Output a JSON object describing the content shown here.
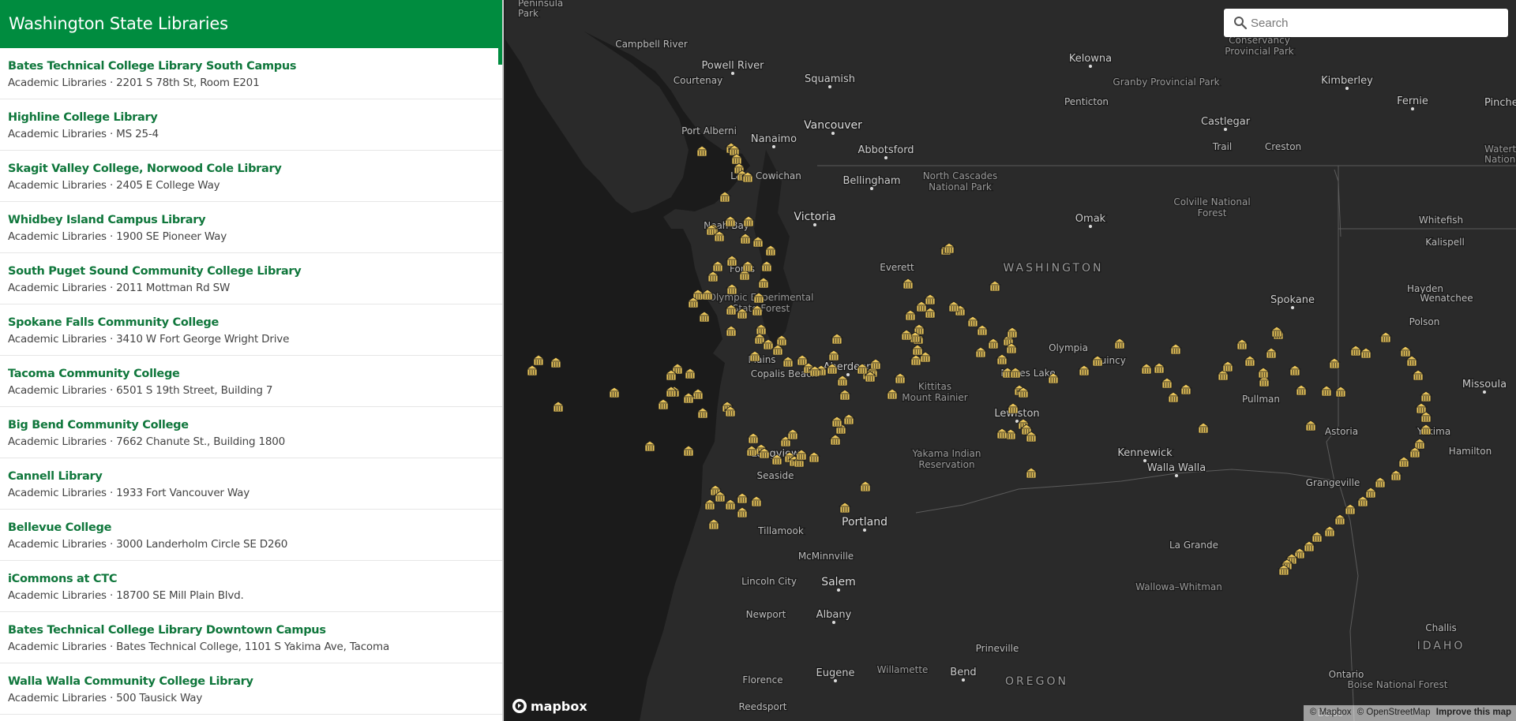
{
  "sidebar": {
    "title": "Washington State Libraries",
    "listings": [
      {
        "title": "Bates Technical College Library South Campus",
        "details": "Academic Libraries · 2201 S 78th St, Room E201"
      },
      {
        "title": "Highline College Library",
        "details": "Academic Libraries · MS 25-4"
      },
      {
        "title": "Skagit Valley College, Norwood Cole Library",
        "details": "Academic Libraries · 2405 E College Way"
      },
      {
        "title": "Whidbey Island Campus Library",
        "details": "Academic Libraries · 1900 SE Pioneer Way"
      },
      {
        "title": "South Puget Sound Community College Library",
        "details": "Academic Libraries · 2011 Mottman Rd SW"
      },
      {
        "title": "Spokane Falls Community College",
        "details": "Academic Libraries · 3410 W Fort George Wright Drive"
      },
      {
        "title": "Tacoma Community College",
        "details": "Academic Libraries · 6501 S 19th Street, Building 7"
      },
      {
        "title": "Big Bend Community College",
        "details": "Academic Libraries · 7662 Chanute St., Building 1800"
      },
      {
        "title": "Cannell Library",
        "details": "Academic Libraries · 1933 Fort Vancouver Way"
      },
      {
        "title": "Bellevue College",
        "details": "Academic Libraries · 3000 Landerholm Circle SE D260"
      },
      {
        "title": "iCommons at CTC",
        "details": "Academic Libraries · 18700 SE Mill Plain Blvd."
      },
      {
        "title": "Bates Technical College Library Downtown Campus",
        "details": "Academic Libraries · Bates Technical College, 1101 S Yakima Ave, Tacoma"
      },
      {
        "title": "Walla Walla Community College Library",
        "details": "Academic Libraries · 500 Tausick Way"
      }
    ]
  },
  "map": {
    "search_placeholder": "Search",
    "logo_text": "mapbox",
    "attribution": [
      "© Mapbox",
      "© OpenStreetMap"
    ],
    "improve_label": "Improve this map",
    "marker_color": "#e8c45a",
    "place_labels": [
      "Peninsula",
      "Park",
      "Campbell River",
      "Powell River",
      "Squamish",
      "Kelowna",
      "Conservancy",
      "Provincial Park",
      "Courtenay",
      "Granby Provincial Park",
      "Kimberley",
      "Fernie",
      "Pincher Cree",
      "Port Alberni",
      "Nanaimo",
      "Vancouver",
      "Penticton",
      "Castlegar",
      "Trail",
      "Creston",
      "Waterton Lak",
      "National Par",
      "Abbotsford",
      "Lake Cowichan",
      "North Cascades",
      "National Park",
      "Bellingham",
      "Colville National",
      "Forest",
      "Neah Bay",
      "Victoria",
      "Omak",
      "Whitefish",
      "Kalispell",
      "Forks",
      "Everett",
      "WASHINGTON",
      "Spokane",
      "Hayden",
      "Olympic Experimental",
      "State Forest",
      "Wenatchee",
      "Polson",
      "Plains",
      "Copalis Beach",
      "Aberdeen",
      "Olympia",
      "Quincy",
      "Moses Lake",
      "Kittitas",
      "Mount Rainier",
      "Missoula",
      "Pullman",
      "Yakima",
      "Lewiston",
      "Astoria",
      "Longview",
      "Yakama Indian",
      "Reservation",
      "Kennewick",
      "Walla Walla",
      "Hamilton",
      "Seaside",
      "Grangeville",
      "Portland",
      "Tillamook",
      "McMinnville",
      "La Grande",
      "Lincoln City",
      "Salem",
      "Wallowa–Whitman",
      "Newport",
      "Albany",
      "Challis",
      "Prineville",
      "IDAHO",
      "Eugene",
      "Willamette",
      "Bend",
      "OREGON",
      "Florence",
      "Ontario",
      "Boise National Forest",
      "Reedsport",
      "Boise"
    ]
  }
}
